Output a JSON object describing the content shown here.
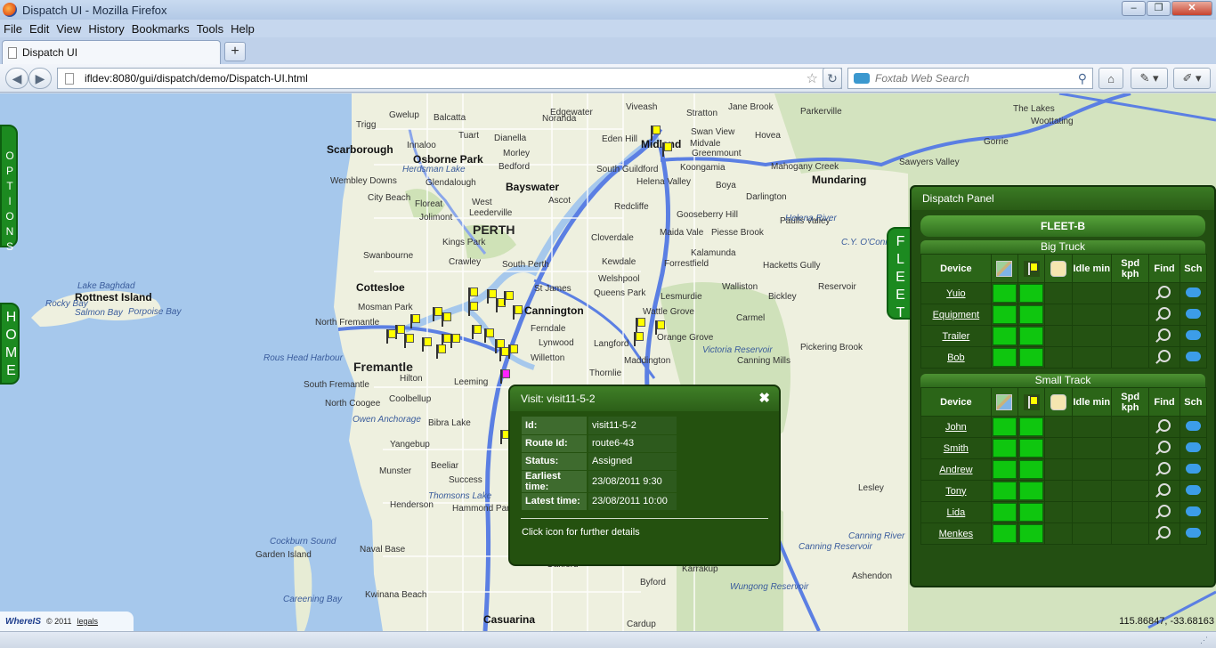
{
  "window": {
    "title": "Dispatch UI - Mozilla Firefox"
  },
  "menu": [
    "File",
    "Edit",
    "View",
    "History",
    "Bookmarks",
    "Tools",
    "Help"
  ],
  "tab": {
    "label": "Dispatch UI"
  },
  "nav": {
    "url": "ifldev:8080/gui/dispatch/demo/Dispatch-UI.html",
    "search_placeholder": "Foxtab Web Search"
  },
  "sidetabs": {
    "options": "OPTIONS",
    "home": "HOME",
    "fleet": "FLEET"
  },
  "map": {
    "places": [
      {
        "t": "Trigg"
      },
      {
        "t": "Gwelup"
      },
      {
        "t": "Balcatta"
      },
      {
        "t": "Tuart"
      },
      {
        "t": "Dianella"
      },
      {
        "t": "Morley"
      },
      {
        "t": "Innaloo"
      },
      {
        "t": "Scarborough"
      },
      {
        "t": "Osborne Park"
      },
      {
        "t": "Bedford"
      },
      {
        "t": "Wembley Downs"
      },
      {
        "t": "Glendalough"
      },
      {
        "t": "Bayswater"
      },
      {
        "t": "City Beach"
      },
      {
        "t": "Floreat"
      },
      {
        "t": "Jolimont"
      },
      {
        "t": "Ascot"
      },
      {
        "t": "Leederville"
      },
      {
        "t": "Redcliffe"
      },
      {
        "t": "West"
      },
      {
        "t": "PERTH"
      },
      {
        "t": "Kings Park"
      },
      {
        "t": "Cloverdale"
      },
      {
        "t": "Swanbourne"
      },
      {
        "t": "Crawley"
      },
      {
        "t": "South Perth"
      },
      {
        "t": "Kewdale"
      },
      {
        "t": "Cottesloe"
      },
      {
        "t": "Welshpool"
      },
      {
        "t": "St James"
      },
      {
        "t": "Queens Park"
      },
      {
        "t": "Mosman Park"
      },
      {
        "t": "Cannington"
      },
      {
        "t": "North Fremantle"
      },
      {
        "t": "Ferndale"
      },
      {
        "t": "Lynwood"
      },
      {
        "t": "Fremantle"
      },
      {
        "t": "Willetton"
      },
      {
        "t": "Langford"
      },
      {
        "t": "Hilton"
      },
      {
        "t": "Leeming"
      },
      {
        "t": "South Fremantle"
      },
      {
        "t": "North Coogee"
      },
      {
        "t": "Coolbellup"
      },
      {
        "t": "Bibra Lake"
      },
      {
        "t": "Yangebup"
      },
      {
        "t": "Munster"
      },
      {
        "t": "Beeliar"
      },
      {
        "t": "Success"
      },
      {
        "t": "Henderson"
      },
      {
        "t": "Hammond Park"
      },
      {
        "t": "Naval Base"
      },
      {
        "t": "Garden Island"
      },
      {
        "t": "Kwinana Beach"
      },
      {
        "t": "Casuarina"
      },
      {
        "t": "Oakford"
      },
      {
        "t": "Karrakup"
      },
      {
        "t": "Byford"
      },
      {
        "t": "Cardup"
      },
      {
        "t": "Midland"
      },
      {
        "t": "Viveash"
      },
      {
        "t": "Stratton"
      },
      {
        "t": "Jane Brook"
      },
      {
        "t": "Parkerville"
      },
      {
        "t": "Swan View"
      },
      {
        "t": "Hovea"
      },
      {
        "t": "Midvale"
      },
      {
        "t": "Greenmount"
      },
      {
        "t": "Koongamia"
      },
      {
        "t": "Mahogany Creek"
      },
      {
        "t": "Mundaring"
      },
      {
        "t": "Helena Valley"
      },
      {
        "t": "Boya"
      },
      {
        "t": "Darlington"
      },
      {
        "t": "Gooseberry Hill"
      },
      {
        "t": "Maida Vale"
      },
      {
        "t": "Piesse Brook"
      },
      {
        "t": "Paulls Valley"
      },
      {
        "t": "Kalamunda"
      },
      {
        "t": "Forrestfield"
      },
      {
        "t": "Hacketts Gully"
      },
      {
        "t": "Walliston"
      },
      {
        "t": "Bickley"
      },
      {
        "t": "Reservoir"
      },
      {
        "t": "Lesmurdie"
      },
      {
        "t": "Wattle Grove"
      },
      {
        "t": "Orange Grove"
      },
      {
        "t": "Carmel"
      },
      {
        "t": "Maddington"
      },
      {
        "t": "Pickering Brook"
      },
      {
        "t": "Canning Mills"
      },
      {
        "t": "Thornlie"
      },
      {
        "t": "Lesley"
      },
      {
        "t": "Ashendon"
      },
      {
        "t": "The Lakes"
      },
      {
        "t": "Woottating"
      },
      {
        "t": "Gorrie"
      },
      {
        "t": "Sawyers Valley"
      },
      {
        "t": "Edgewater"
      },
      {
        "t": "Eden Hill"
      },
      {
        "t": "South Guildford"
      },
      {
        "t": "Noranda"
      },
      {
        "t": "Rottnest Island"
      },
      {
        "t": "Lake Baghdad"
      },
      {
        "t": "Rocky Bay"
      },
      {
        "t": "Salmon Bay"
      },
      {
        "t": "Porpoise Bay"
      },
      {
        "t": "Rous Head Harbour"
      },
      {
        "t": "Herdsman Lake"
      },
      {
        "t": "Owen Anchorage"
      },
      {
        "t": "Thomsons Lake"
      },
      {
        "t": "Cockburn Sound"
      },
      {
        "t": "Careening Bay"
      },
      {
        "t": "Victoria Reservoir"
      },
      {
        "t": "Helena River"
      },
      {
        "t": "Canning Reservoir"
      },
      {
        "t": "Wungong Reservoir"
      },
      {
        "t": "Canning River"
      },
      {
        "t": "C.Y. O'Connor Lake"
      }
    ]
  },
  "dispatch": {
    "title": "Dispatch Panel",
    "fleet": "FLEET-B",
    "headers": {
      "device": "Device",
      "idle": "Idle min",
      "speed": "Spd kph",
      "find": "Find",
      "sch": "Sch"
    },
    "groups": [
      {
        "name": "Big Truck",
        "devices": [
          "Yuio",
          "Equipment",
          "Trailer",
          "Bob"
        ]
      },
      {
        "name": "Small Track",
        "devices": [
          "John",
          "Smith",
          "Andrew",
          "Tony",
          "Lida",
          "Menkes"
        ]
      }
    ]
  },
  "popup": {
    "title": "Visit: visit11-5-2",
    "rows": [
      {
        "k": "Id:",
        "v": "visit11-5-2"
      },
      {
        "k": "Route Id:",
        "v": "route6-43"
      },
      {
        "k": "Status:",
        "v": "Assigned"
      },
      {
        "k": "Earliest time:",
        "v": "23/08/2011 9:30"
      },
      {
        "k": "Latest time:",
        "v": "23/08/2011 10:00"
      }
    ],
    "note": "Click icon for further details"
  },
  "footer": {
    "logo": "WhereIS",
    "copyright": "© 2011",
    "legals": "legals",
    "coords": "115.86847, -33.68163"
  }
}
